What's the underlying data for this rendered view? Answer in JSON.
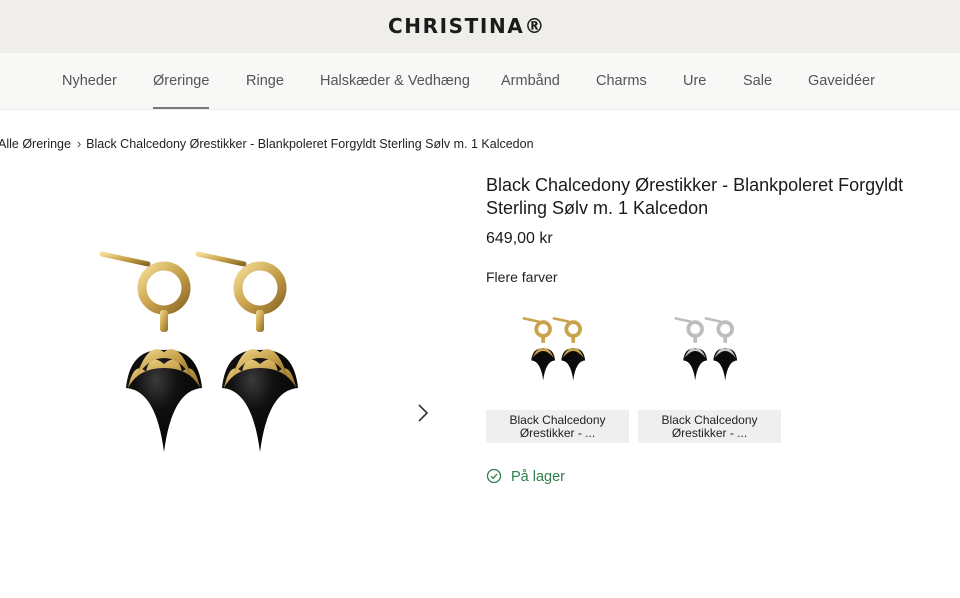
{
  "header": {
    "logo": "CHRISTINA®"
  },
  "nav": {
    "items": [
      "Nyheder",
      "Øreringe",
      "Ringe",
      "Halskæder & Vedhæng",
      "Armbånd",
      "Charms",
      "Ure",
      "Sale",
      "Gaveidéer"
    ],
    "active": "Øreringe"
  },
  "breadcrumb": {
    "parent": "Alle Øreringe",
    "current": "Black Chalcedony Ørestikker - Blankpoleret Forgyldt Sterling Sølv m. 1 Kalcedon"
  },
  "product": {
    "title": "Black Chalcedony Ørestikker - Blankpoleret Forgyldt Sterling Sølv m. 1 Kalcedon",
    "price": "649,00 kr",
    "more_colors_label": "Flere farver",
    "variants": [
      {
        "label": "Black Chalcedony Ørestikker - ...",
        "metal": "gold"
      },
      {
        "label": "Black Chalcedony Ørestikker - ...",
        "metal": "silver"
      }
    ],
    "stock": "På lager"
  },
  "colors": {
    "accent_green": "#2e7d4a",
    "gold": "#c9a24c",
    "silver": "#c8c8c8",
    "stone": "#0b0b0b"
  },
  "icons": {
    "next": "chevron-right-icon",
    "stock": "check-circle-icon"
  }
}
